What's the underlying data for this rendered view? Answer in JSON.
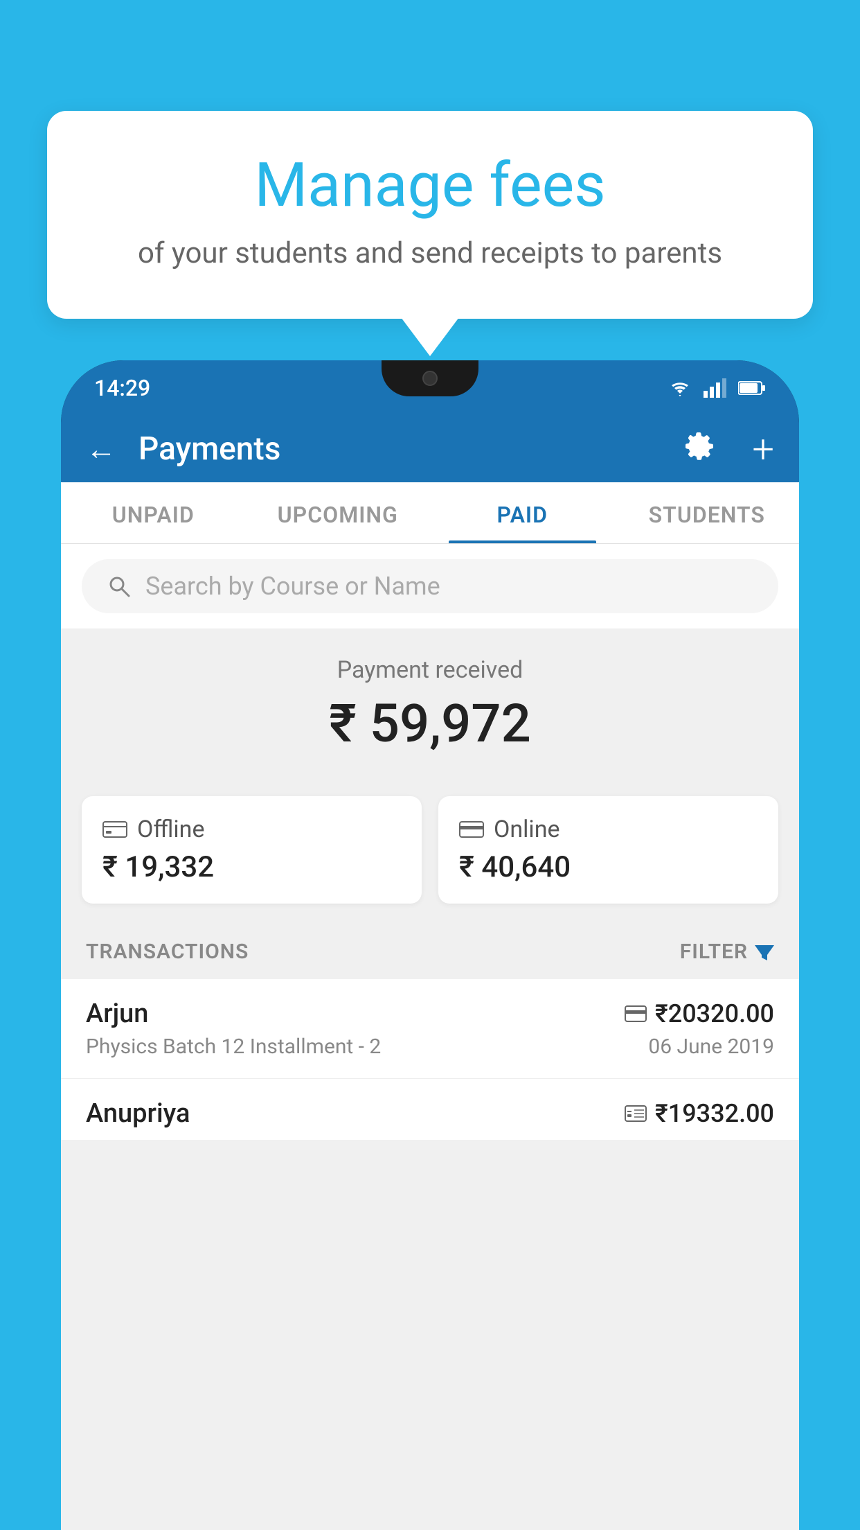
{
  "background_color": "#29b6e8",
  "bubble": {
    "title": "Manage fees",
    "subtitle": "of your students and send receipts to parents"
  },
  "status_bar": {
    "time": "14:29",
    "wifi": "▼",
    "signal": "▲",
    "battery": "▐"
  },
  "header": {
    "title": "Payments",
    "back_label": "←",
    "gear_label": "⚙",
    "plus_label": "+"
  },
  "tabs": [
    {
      "id": "unpaid",
      "label": "UNPAID",
      "active": false
    },
    {
      "id": "upcoming",
      "label": "UPCOMING",
      "active": false
    },
    {
      "id": "paid",
      "label": "PAID",
      "active": true
    },
    {
      "id": "students",
      "label": "STUDENTS",
      "active": false
    }
  ],
  "search": {
    "placeholder": "Search by Course or Name"
  },
  "payment": {
    "received_label": "Payment received",
    "total_amount": "₹ 59,972",
    "offline": {
      "label": "Offline",
      "amount": "₹ 19,332"
    },
    "online": {
      "label": "Online",
      "amount": "₹ 40,640"
    }
  },
  "transactions": {
    "header_label": "TRANSACTIONS",
    "filter_label": "FILTER",
    "items": [
      {
        "name": "Arjun",
        "amount": "₹20320.00",
        "course": "Physics Batch 12 Installment - 2",
        "date": "06 June 2019",
        "payment_type": "card"
      },
      {
        "name": "Anupriya",
        "amount": "₹19332.00",
        "course": "",
        "date": "",
        "payment_type": "cash"
      }
    ]
  },
  "icons": {
    "search": "🔍",
    "gear": "⚙",
    "filter_triangle": "▼",
    "card": "💳",
    "cash": "💵",
    "offline_icon": "🗂",
    "online_icon": "💳"
  }
}
